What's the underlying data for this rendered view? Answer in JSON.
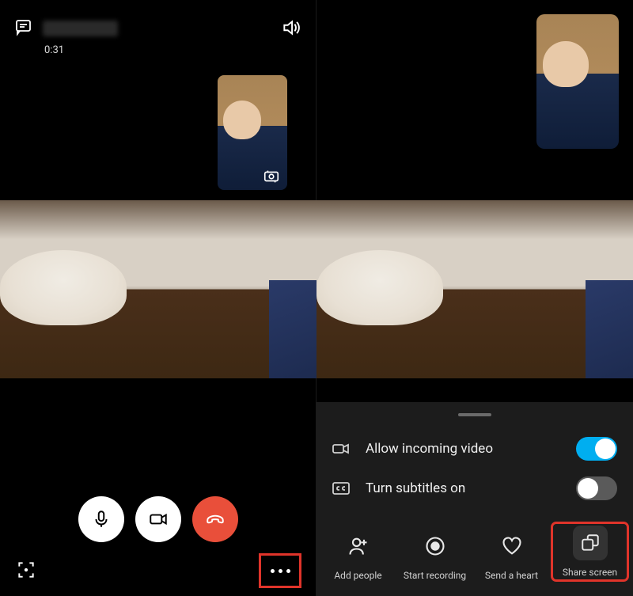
{
  "left": {
    "call_duration": "0:31"
  },
  "right": {
    "settings": {
      "allow_video_label": "Allow incoming video",
      "allow_video_on": true,
      "subtitles_label": "Turn subtitles on",
      "subtitles_on": false
    },
    "actions": {
      "add_people": "Add people",
      "start_recording": "Start recording",
      "send_heart": "Send a heart",
      "share_screen": "Share screen"
    }
  }
}
